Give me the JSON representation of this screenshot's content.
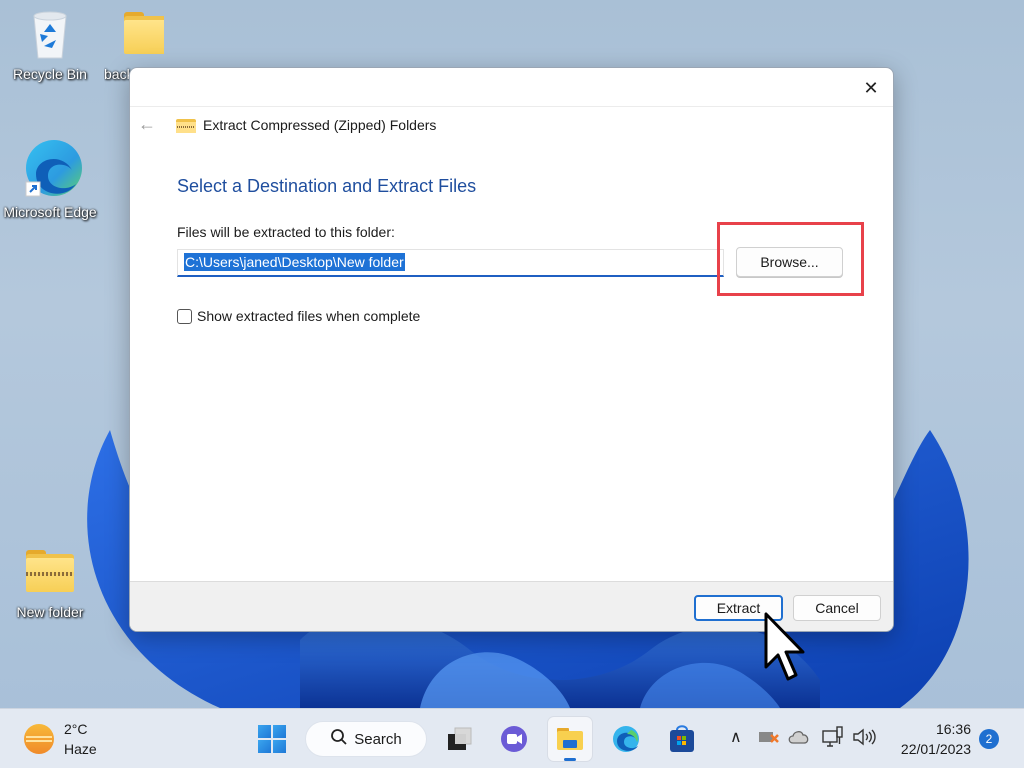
{
  "desktop": {
    "icons": [
      {
        "label": "Recycle Bin",
        "icon": "recycle-bin-icon"
      },
      {
        "label": "backup",
        "icon": "folder-icon"
      },
      {
        "label": "Microsoft Edge",
        "icon": "edge-icon"
      },
      {
        "label": "New folder",
        "icon": "zip-folder-icon"
      }
    ]
  },
  "dialog": {
    "nav_title": "Extract Compressed (Zipped) Folders",
    "heading": "Select a Destination and Extract Files",
    "field_label": "Files will be extracted to this folder:",
    "path_value": "C:\\Users\\janed\\Desktop\\New folder",
    "browse_label": "Browse...",
    "checkbox_label": "Show extracted files when complete",
    "checkbox_checked": false,
    "extract_label": "Extract",
    "cancel_label": "Cancel",
    "close_glyph": "✕",
    "back_glyph": "←"
  },
  "taskbar": {
    "weather_temp": "2°C",
    "weather_desc": "Haze",
    "search_label": "Search",
    "time": "16:36",
    "date": "22/01/2023",
    "notification_count": "2",
    "tray_chevron": "∧",
    "volume_glyph": "🔊"
  },
  "colors": {
    "accent": "#1f6fd0",
    "heading": "#1f4e9e",
    "highlight": "#e8414a"
  }
}
